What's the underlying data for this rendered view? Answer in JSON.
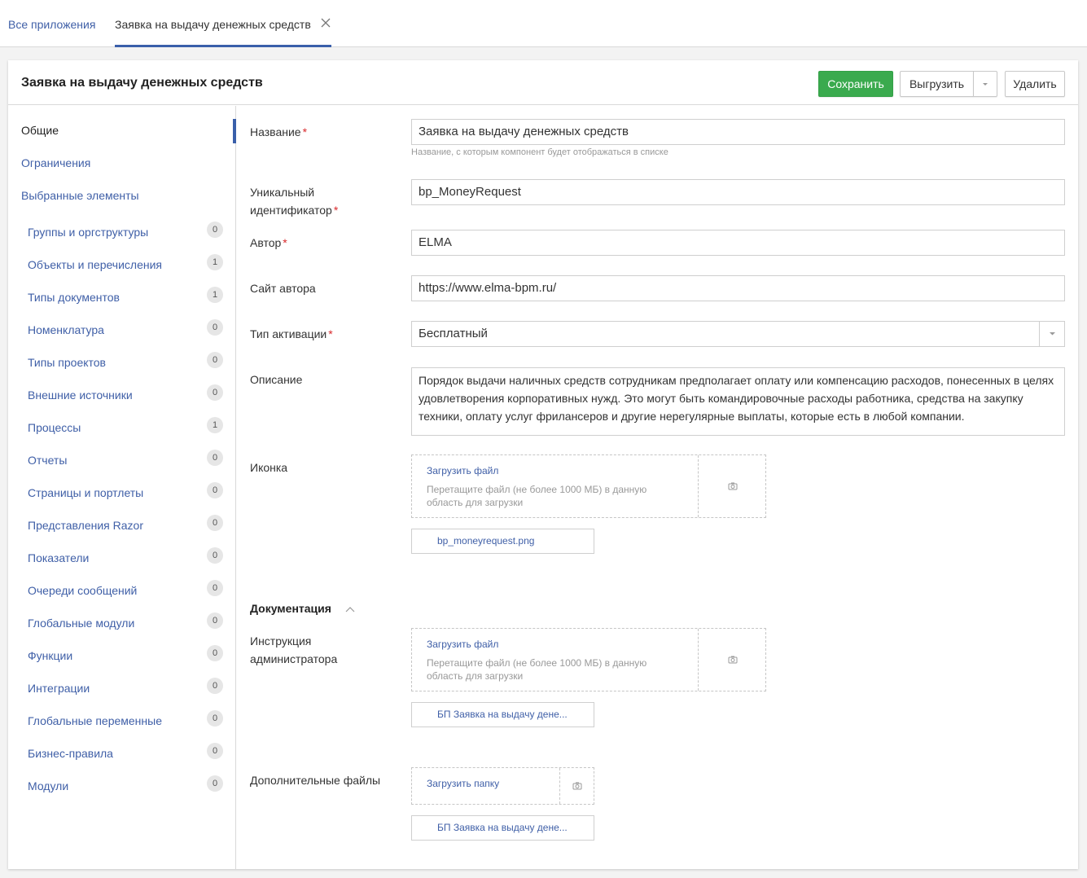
{
  "tabs": {
    "all_apps": "Все приложения",
    "current": "Заявка на выдачу денежных средств"
  },
  "header": {
    "title": "Заявка на выдачу денежных средств",
    "save": "Сохранить",
    "export": "Выгрузить",
    "delete": "Удалить"
  },
  "sidebar": {
    "general": "Общие",
    "restrictions": "Ограничения",
    "selected": "Выбранные элементы",
    "items": [
      {
        "label": "Группы и оргструктуры",
        "count": "0"
      },
      {
        "label": "Объекты и перечисления",
        "count": "1"
      },
      {
        "label": "Типы документов",
        "count": "1"
      },
      {
        "label": "Номенклатура",
        "count": "0"
      },
      {
        "label": "Типы проектов",
        "count": "0"
      },
      {
        "label": "Внешние источники",
        "count": "0"
      },
      {
        "label": "Процессы",
        "count": "1"
      },
      {
        "label": "Отчеты",
        "count": "0"
      },
      {
        "label": "Страницы и портлеты",
        "count": "0"
      },
      {
        "label": "Представления Razor",
        "count": "0"
      },
      {
        "label": "Показатели",
        "count": "0"
      },
      {
        "label": "Очереди сообщений",
        "count": "0"
      },
      {
        "label": "Глобальные модули",
        "count": "0"
      },
      {
        "label": "Функции",
        "count": "0"
      },
      {
        "label": "Интеграции",
        "count": "0"
      },
      {
        "label": "Глобальные переменные",
        "count": "0"
      },
      {
        "label": "Бизнес-правила",
        "count": "0"
      },
      {
        "label": "Модули",
        "count": "0"
      }
    ]
  },
  "form": {
    "name_label": "Название",
    "name_value": "Заявка на выдачу денежных средств",
    "name_hint": "Название, с которым компонент будет отображаться в списке",
    "uid_label_1": "Уникальный",
    "uid_label_2": "идентификатор",
    "uid_value": "bp_MoneyRequest",
    "author_label": "Автор",
    "author_value": "ELMA",
    "site_label": "Сайт автора",
    "site_value": "https://www.elma-bpm.ru/",
    "activation_label": "Тип активации",
    "activation_value": "Бесплатный",
    "description_label": "Описание",
    "description_value": "Порядок выдачи наличных средств сотрудникам предполагает оплату или компенсацию расходов, понесенных в целях удовлетворения корпоративных нужд. Это могут быть командировочные расходы работника, средства на закупку техники, оплату услуг фрилансеров и другие нерегулярные выплаты, которые есть в любой компании.",
    "icon_label": "Иконка",
    "upload_file": "Загрузить файл",
    "upload_hint": "Перетащите файл (не более 1000 МБ) в данную область для загрузки",
    "icon_file": "bp_moneyrequest.png",
    "doc_section": "Документация",
    "admin_label_1": "Инструкция",
    "admin_label_2": "администратора",
    "admin_file": "БП Заявка на выдачу дене...",
    "extra_label": "Дополнительные файлы",
    "upload_folder": "Загрузить папку",
    "extra_file": "БП Заявка на выдачу дене..."
  },
  "colors": {
    "accent": "#3a5faa",
    "save": "#3aaa4e",
    "required": "#d9292b"
  }
}
